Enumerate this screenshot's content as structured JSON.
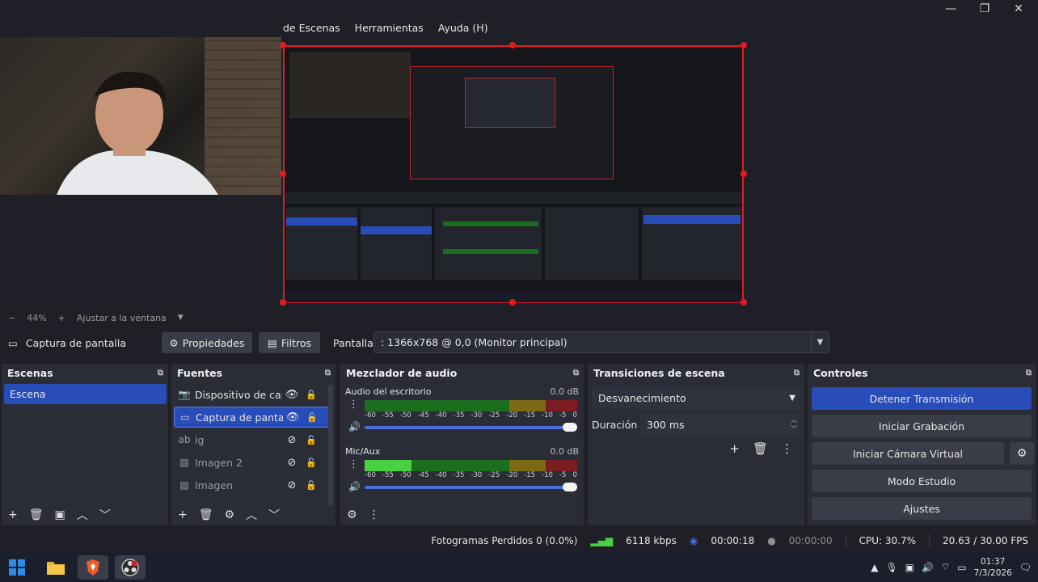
{
  "menu": [
    "de Escenas",
    "Herramientas",
    "Ayuda (H)"
  ],
  "window_controls": [
    "—",
    "❐",
    "✕"
  ],
  "zoom": {
    "minus": "−",
    "value": "44%",
    "plus": "+",
    "fit_label": "Ajustar a la ventana"
  },
  "source_toolbar": {
    "source_name": "Captura de pantalla",
    "properties_label": "Propiedades",
    "filters_label": "Filtros",
    "display_label": "Pantalla",
    "display_value": ": 1366x768 @ 0,0 (Monitor principal)"
  },
  "docks": {
    "scenes": {
      "title": "Escenas",
      "items": [
        "Escena"
      ]
    },
    "sources": {
      "title": "Fuentes",
      "items": [
        {
          "name": "Dispositivo de capt",
          "icon": "camera-icon",
          "visible": true
        },
        {
          "name": "Captura de pantalla",
          "icon": "monitor-icon",
          "visible": true,
          "selected": true
        },
        {
          "name": "ig",
          "icon": "text-icon",
          "visible": false
        },
        {
          "name": "Imagen 2",
          "icon": "image-icon",
          "visible": false
        },
        {
          "name": "Imagen",
          "icon": "image-icon",
          "visible": false
        }
      ]
    },
    "mixer": {
      "title": "Mezclador de audio",
      "channels": [
        {
          "name": "Audio del escritorio",
          "db": "0.0 dB",
          "level": 0.0
        },
        {
          "name": "Mic/Aux",
          "db": "0.0 dB",
          "level": 0.22
        }
      ],
      "ticks": [
        "-60",
        "-55",
        "-50",
        "-45",
        "-40",
        "-35",
        "-30",
        "-25",
        "-20",
        "-15",
        "-10",
        "-5",
        "0"
      ]
    },
    "transitions": {
      "title": "Transiciones de escena",
      "selected": "Desvanecimiento",
      "duration_label": "Duración",
      "duration_value": "300 ms"
    },
    "controls": {
      "title": "Controles",
      "buttons": [
        "Detener Transmisión",
        "Iniciar Grabación",
        "Iniciar Cámara Virtual",
        "Modo Estudio",
        "Ajustes"
      ]
    }
  },
  "status": {
    "dropped": "Fotogramas Perdidos 0 (0.0%)",
    "bitrate": "6118 kbps",
    "stream_time": "00:00:18",
    "rec_time": "00:00:00",
    "cpu": "CPU: 30.7%",
    "fps": "20.63 / 30.00 FPS"
  },
  "taskbar": {
    "time": "01:37",
    "date": "7/3/2026"
  },
  "colors": {
    "accent": "#284cb8",
    "selection_border": "#e01b24",
    "panel": "#2a2c36",
    "background": "#1f2027"
  }
}
